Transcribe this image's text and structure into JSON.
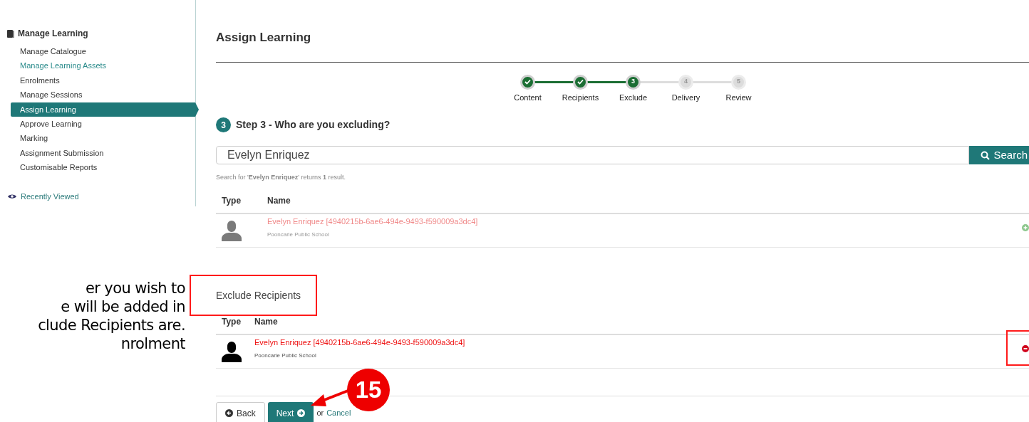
{
  "sidebar": {
    "section": "Manage Learning",
    "items": [
      {
        "label": "Manage Catalogue",
        "selected": false,
        "visited": false
      },
      {
        "label": "Manage Learning Assets",
        "selected": false,
        "visited": true
      },
      {
        "label": "Enrolments",
        "selected": false,
        "visited": false
      },
      {
        "label": "Manage Sessions",
        "selected": false,
        "visited": false
      },
      {
        "label": "Assign Learning",
        "selected": true,
        "visited": false
      },
      {
        "label": "Approve Learning",
        "selected": false,
        "visited": false
      },
      {
        "label": "Marking",
        "selected": false,
        "visited": false
      },
      {
        "label": "Assignment Submission",
        "selected": false,
        "visited": false
      },
      {
        "label": "Customisable Reports",
        "selected": false,
        "visited": false
      }
    ],
    "recent": "Recently Viewed"
  },
  "doc_text": [
    "er you wish to",
    "e will be added in",
    "clude Recipients are.",
    "nrolment"
  ],
  "page_title": "Assign Learning",
  "steps": [
    {
      "label": "Content",
      "done": true,
      "current": false
    },
    {
      "label": "Recipients",
      "done": true,
      "current": false
    },
    {
      "number": "3",
      "label": "Exclude",
      "done": false,
      "current": true
    },
    {
      "number": "4",
      "label": "Delivery",
      "done": false,
      "current": false
    },
    {
      "number": "5",
      "label": "Review",
      "done": false,
      "current": false
    }
  ],
  "step_heading": {
    "number": "3",
    "text": "Step 3 - Who are you excluding?"
  },
  "search": {
    "value": "Evelyn Enriquez",
    "button": "Search"
  },
  "result_summary": "Search for '**Evelyn Enriquez**' returns **1** result.",
  "results": {
    "columns": [
      "Type",
      "Name"
    ],
    "rows": [
      {
        "name": "Evelyn Enriquez [4940215b-6ae6-494e-9493-f590009a3dc4]",
        "school": "Pooncarie Public School",
        "kind": "add"
      }
    ]
  },
  "exclude": {
    "heading": "Exclude Recipients",
    "columns": [
      "Type",
      "Name"
    ],
    "rows": [
      {
        "name": "Evelyn Enriquez [4940215b-6ae6-494e-9493-f590009a3dc4]",
        "school": "Pooncarie Public School",
        "kind": "remove"
      }
    ]
  },
  "buttons": {
    "back": "Back",
    "next": "Next",
    "or": "or",
    "cancel": "Cancel"
  },
  "callout": "15"
}
